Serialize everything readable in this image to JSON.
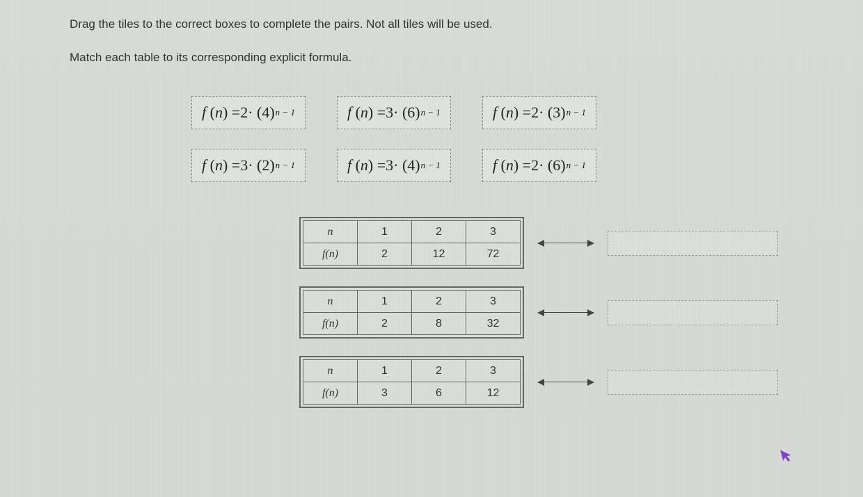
{
  "instructions": "Drag the tiles to the correct boxes to complete the pairs. Not all tiles will be used.",
  "subinstructions": "Match each table to its corresponding explicit formula.",
  "tiles": {
    "row1": [
      {
        "f": "f",
        "var": "n",
        "coef": "2",
        "base": "4",
        "exp": "n − 1"
      },
      {
        "f": "f",
        "var": "n",
        "coef": "3",
        "base": "6",
        "exp": "n − 1"
      },
      {
        "f": "f",
        "var": "n",
        "coef": "2",
        "base": "3",
        "exp": "n − 1"
      }
    ],
    "row2": [
      {
        "f": "f",
        "var": "n",
        "coef": "3",
        "base": "2",
        "exp": "n − 1"
      },
      {
        "f": "f",
        "var": "n",
        "coef": "3",
        "base": "4",
        "exp": "n − 1"
      },
      {
        "f": "f",
        "var": "n",
        "coef": "2",
        "base": "6",
        "exp": "n − 1"
      }
    ]
  },
  "tables": [
    {
      "header_n": "n",
      "header_fn": "f(n)",
      "n_values": [
        "1",
        "2",
        "3"
      ],
      "fn_values": [
        "2",
        "12",
        "72"
      ]
    },
    {
      "header_n": "n",
      "header_fn": "f(n)",
      "n_values": [
        "1",
        "2",
        "3"
      ],
      "fn_values": [
        "2",
        "8",
        "32"
      ]
    },
    {
      "header_n": "n",
      "header_fn": "f(n)",
      "n_values": [
        "1",
        "2",
        "3"
      ],
      "fn_values": [
        "3",
        "6",
        "12"
      ]
    }
  ]
}
